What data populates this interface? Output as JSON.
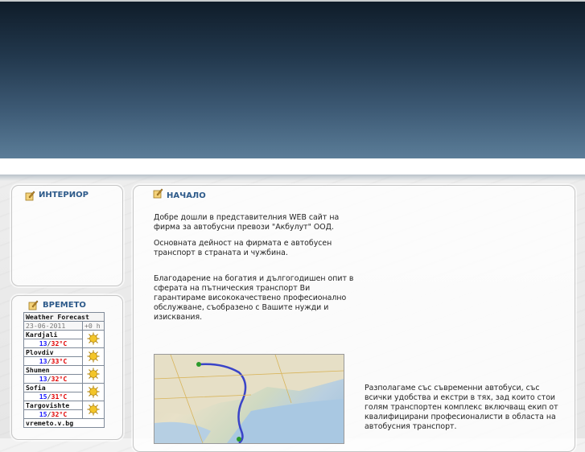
{
  "sidebar": {
    "interior_title": "ИНТЕРИОР",
    "weather_title": "ВРЕМЕТО",
    "weather_widget": {
      "header": "Weather Forecast",
      "date": "23-06-2011",
      "offset": "+0 h",
      "cities": [
        {
          "name": "Kardjali",
          "low": "13",
          "high": "32",
          "unit": "°C"
        },
        {
          "name": "Plovdiv",
          "low": "13",
          "high": "33",
          "unit": "°C"
        },
        {
          "name": "Shumen",
          "low": "13",
          "high": "32",
          "unit": "°C"
        },
        {
          "name": "Sofia",
          "low": "15",
          "high": "31",
          "unit": "°C"
        },
        {
          "name": "Targovishte",
          "low": "15",
          "high": "32",
          "unit": "°C"
        }
      ],
      "sep": "/",
      "footer": "vremeto.v.bg"
    }
  },
  "main": {
    "title": "НАЧАЛО",
    "paragraphs": [
      "Добре дошли в представителния WEB сайт на фирма за автобусни превози \"Акбулут\" ООД.",
      "Основната дейност на фирмата е автобусен транспорт в страната и чужбина.",
      "Благодарение на богатия и дългогодишен опит в сферата на пътническия транспорт Ви гарантираме висококачествено        професионално обслужване, съобразено с Вашите нужди и изисквания.",
      "Разполагаме със съвременни автобуси, със всички удобства и екстри в тях,  зад които стои голям транспортен комплекс включващ екип от квалифицирани професионалисти в областа на автобусния транспорт."
    ]
  },
  "colors": {
    "accent": "#2d5a8a",
    "low_temp": "#1a1aff",
    "high_temp": "#e00000"
  }
}
